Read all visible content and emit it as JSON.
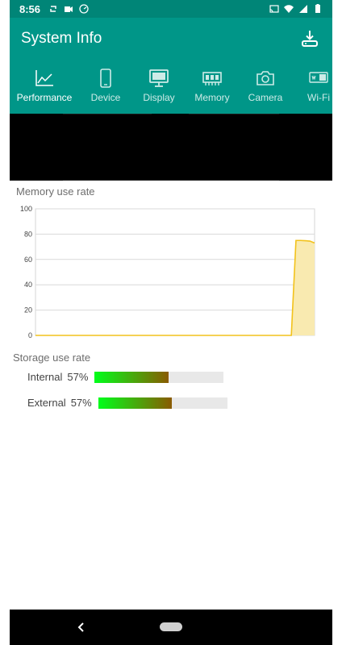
{
  "status_bar": {
    "time": "8:56"
  },
  "app_bar": {
    "title": "System Info"
  },
  "tabs": [
    {
      "label": "Performance",
      "icon": "line-chart-icon",
      "active": true
    },
    {
      "label": "Device",
      "icon": "phone-icon",
      "active": false
    },
    {
      "label": "Display",
      "icon": "monitor-icon",
      "active": false
    },
    {
      "label": "Memory",
      "icon": "memory-chip-icon",
      "active": false
    },
    {
      "label": "Camera",
      "icon": "camera-icon",
      "active": false
    },
    {
      "label": "Wi-Fi",
      "icon": "wifi-icon",
      "active": false
    }
  ],
  "memory": {
    "title": "Memory use rate"
  },
  "chart_data": {
    "type": "area",
    "title": "Memory use rate",
    "ylim": [
      0,
      100
    ],
    "yticks": [
      "0",
      "20",
      "40",
      "60",
      "80",
      "100"
    ],
    "x": [
      0,
      1,
      2,
      3,
      4,
      5,
      6,
      7,
      8,
      9,
      10,
      11,
      12,
      13,
      14,
      15,
      16,
      17,
      18,
      19,
      20,
      21,
      22,
      23,
      24,
      25,
      26,
      27,
      28,
      29,
      30,
      31,
      32,
      33,
      34,
      35,
      36,
      37,
      38,
      39,
      40,
      41,
      42,
      43,
      44,
      45,
      46,
      47,
      48,
      49,
      50,
      51,
      52,
      53,
      54,
      55,
      56,
      57,
      58,
      59,
      60
    ],
    "values": [
      0,
      0,
      0,
      0,
      0,
      0,
      0,
      0,
      0,
      0,
      0,
      0,
      0,
      0,
      0,
      0,
      0,
      0,
      0,
      0,
      0,
      0,
      0,
      0,
      0,
      0,
      0,
      0,
      0,
      0,
      0,
      0,
      0,
      0,
      0,
      0,
      0,
      0,
      0,
      0,
      0,
      0,
      0,
      0,
      0,
      0,
      0,
      0,
      0,
      0,
      0,
      0,
      0,
      0,
      0,
      0,
      75,
      75,
      74.8,
      74.5,
      73
    ],
    "grid": true,
    "line_color": "#f2c21b",
    "fill_color": "#f9eab0"
  },
  "storage": {
    "title": "Storage use rate",
    "items": [
      {
        "label": "Internal",
        "percent_text": "57%",
        "fraction": 0.57
      },
      {
        "label": "External",
        "percent_text": "57%",
        "fraction": 0.57
      }
    ]
  },
  "colors": {
    "status_bar": "#008577",
    "app_bar": "#009688",
    "accent": "#009688"
  }
}
